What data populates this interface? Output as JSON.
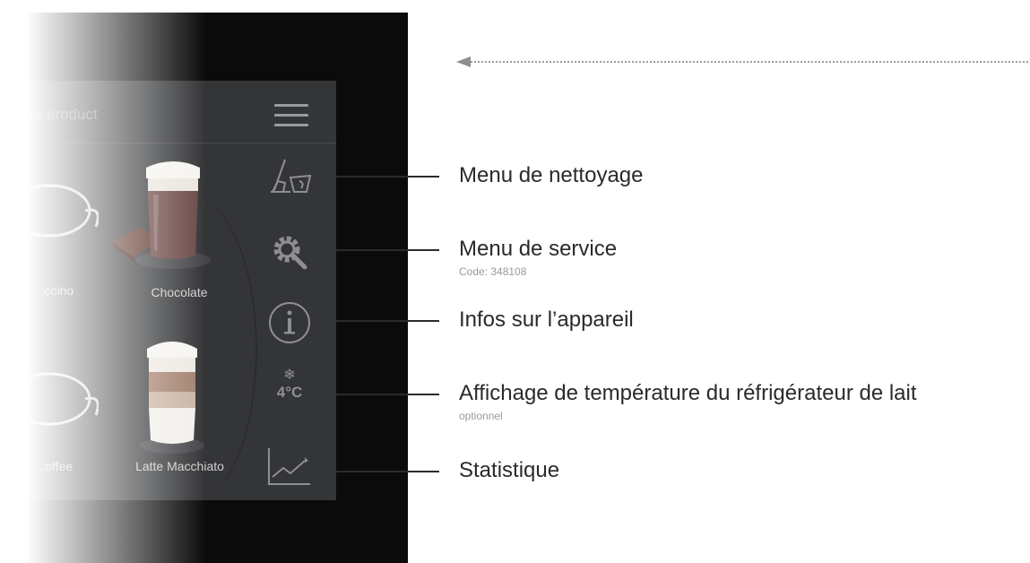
{
  "screen": {
    "header_title": "...ur product",
    "menu_icon": "hamburger-menu-icon",
    "products": [
      {
        "label": "...ccino",
        "icon": "cup-icon"
      },
      {
        "label": "Chocolate",
        "icon": "chocolate-glass-icon"
      },
      {
        "label": "...offee",
        "icon": "cup-icon"
      },
      {
        "label": "Latte Macchiato",
        "icon": "latte-glass-icon"
      }
    ],
    "side_icons": {
      "cleaning": "broom-bucket-icon",
      "service": "gear-wrench-icon",
      "info": "info-icon",
      "temperature": "4°C",
      "snowflake": "snowflake-icon",
      "statistics": "line-chart-icon"
    }
  },
  "callouts": [
    {
      "title": "Menu de nettoyage"
    },
    {
      "title": "Menu de service",
      "sub": "Code: 348108"
    },
    {
      "title": "Infos sur l’appareil"
    },
    {
      "title": "Affichage de température du réfrigérateur de lait",
      "sub": "optionnel"
    },
    {
      "title": "Statistique"
    }
  ],
  "arrow_icon": "left-arrow-icon",
  "colors": {
    "screen_bg": "#343537",
    "frame_bg": "#0b0b0c",
    "icon": "#8e8f92",
    "text_dark": "#2a2a2a",
    "text_muted": "#9a9a9a"
  }
}
